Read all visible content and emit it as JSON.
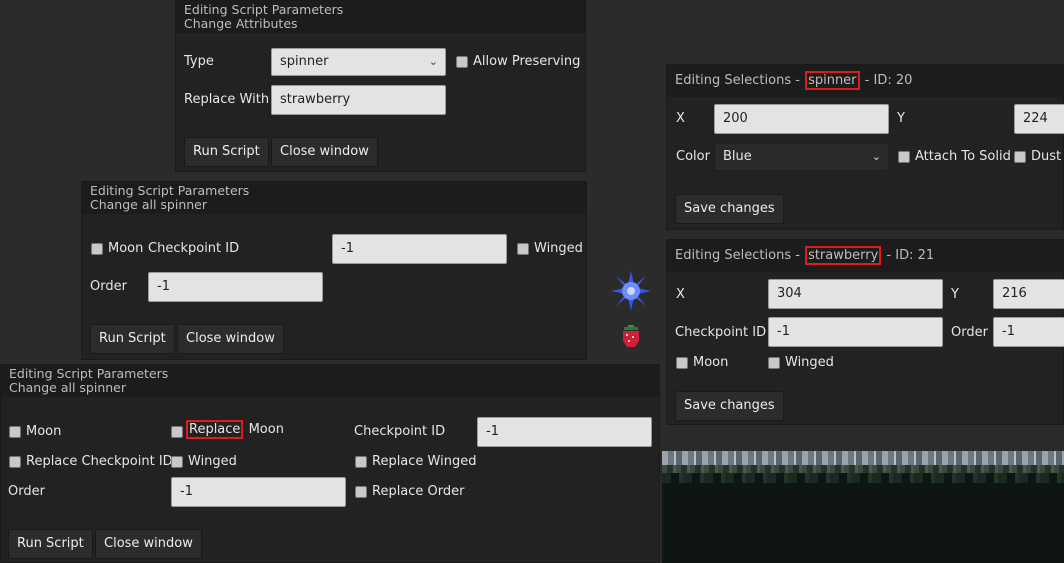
{
  "win_attributes": {
    "title1": "Editing Script Parameters",
    "title2": "Change Attributes",
    "type_label": "Type",
    "type_value": "spinner",
    "allow_preserving": "Allow Preserving",
    "replace_with_label": "Replace With",
    "replace_with_value": "strawberry",
    "run_script": "Run Script",
    "close_window": "Close window"
  },
  "win_spinner_small": {
    "title1": "Editing Script Parameters",
    "title2": "Change all spinner",
    "moon": "Moon",
    "checkpoint_label": "Checkpoint ID",
    "checkpoint_value": "-1",
    "winged": "Winged",
    "order_label": "Order",
    "order_value": "-1",
    "run_script": "Run Script",
    "close_window": "Close window"
  },
  "win_spinner_large": {
    "title1": "Editing Script Parameters",
    "title2": "Change all spinner",
    "moon": "Moon",
    "replace": "Replace",
    "replace_moon_rest": " Moon",
    "checkpoint_label": "Checkpoint ID",
    "checkpoint_value": "-1",
    "replace_checkpoint": "Replace Checkpoint ID",
    "winged": "Winged",
    "replace_winged": "Replace Winged",
    "order_label": "Order",
    "order_value": "-1",
    "replace_order": "Replace Order",
    "run_script": "Run Script",
    "close_window": "Close window"
  },
  "win_sel_spinner": {
    "prefix": "Editing Selections - ",
    "entity": "spinner",
    "suffix": " - ID: 20",
    "x_label": "X",
    "x_value": "200",
    "y_label": "Y",
    "y_value": "224",
    "color_label": "Color",
    "color_value": "Blue",
    "attach_to_solid": "Attach To Solid",
    "dust": "Dust",
    "save_changes": "Save changes"
  },
  "win_sel_strawberry": {
    "prefix": "Editing Selections - ",
    "entity": "strawberry",
    "suffix": " - ID: 21",
    "x_label": "X",
    "x_value": "304",
    "y_label": "Y",
    "y_value": "216",
    "checkpoint_label": "Checkpoint ID",
    "checkpoint_value": "-1",
    "order_label": "Order",
    "order_value": "-1",
    "moon": "Moon",
    "winged": "Winged",
    "save_changes": "Save changes"
  },
  "colors": {
    "highlight": "#e01b1b",
    "window_bg": "#222222",
    "title_bg": "#1c1c1c",
    "canvas_bg": "#2b2b2b"
  },
  "icons": [
    "chevron-down-icon",
    "spinner-sprite-icon",
    "strawberry-sprite-icon"
  ]
}
